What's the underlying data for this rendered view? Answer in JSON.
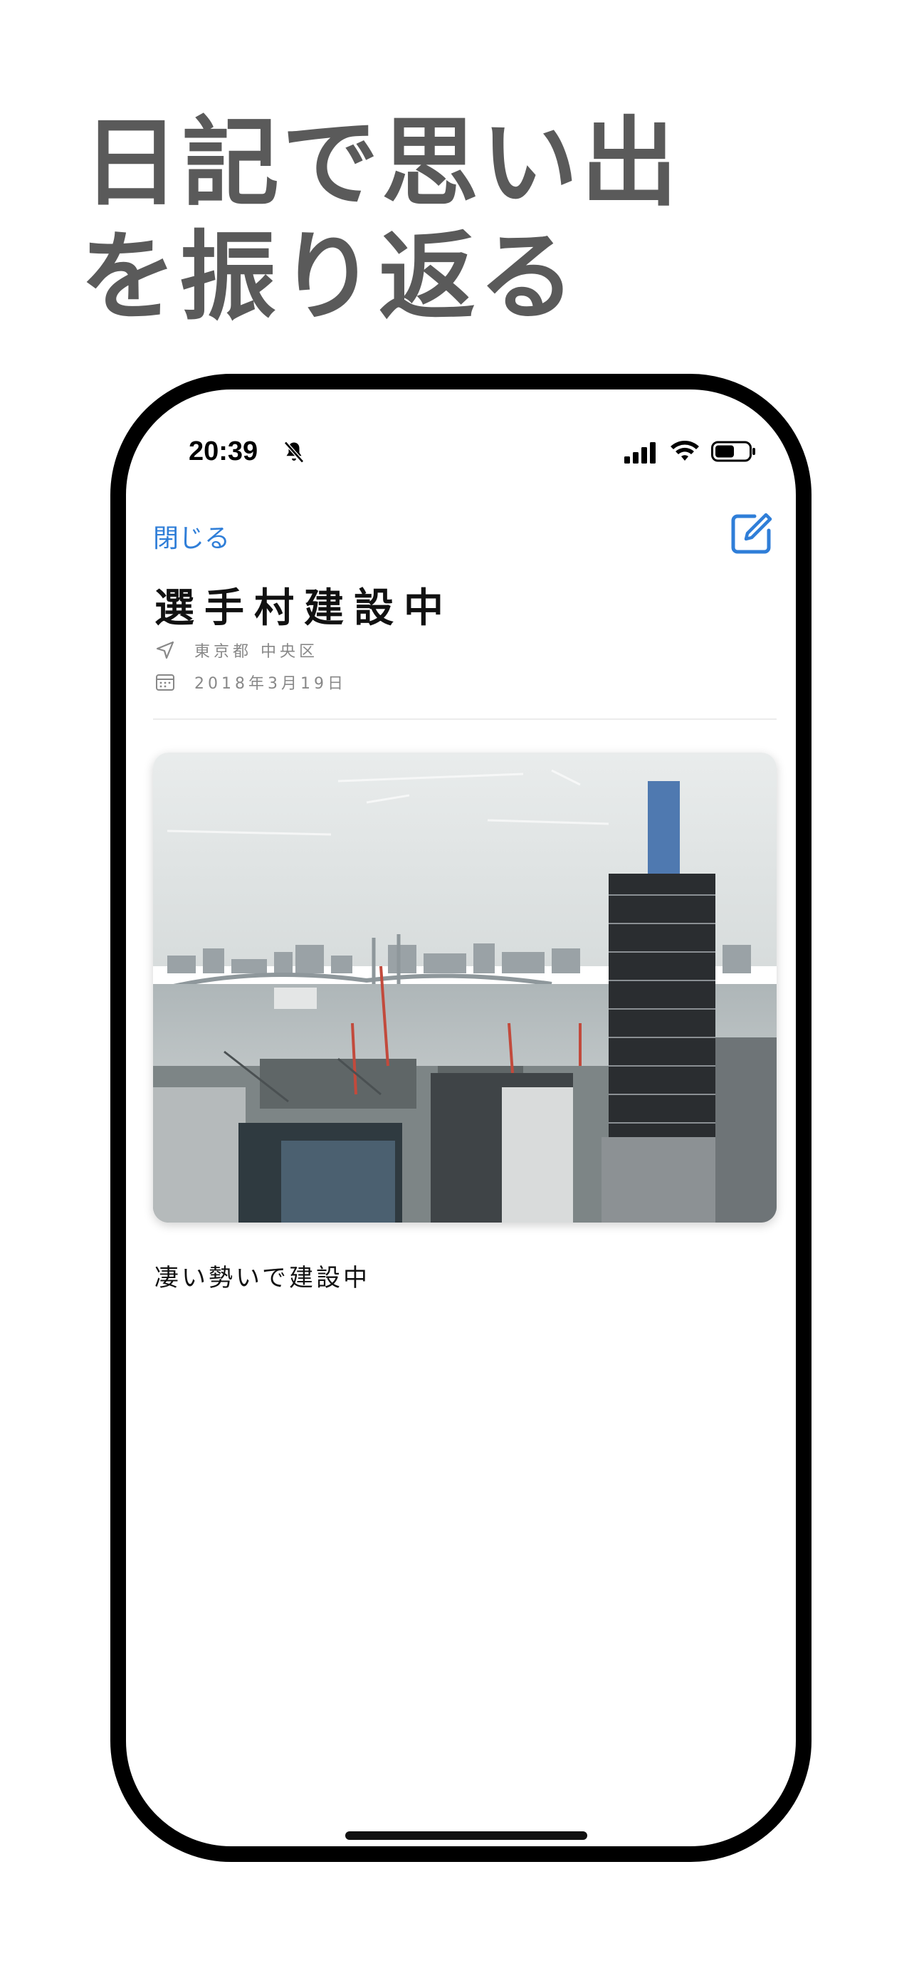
{
  "headline": {
    "line1": "日記で思い出",
    "line2": "を振り返る"
  },
  "status_bar": {
    "time": "20:39",
    "icons": [
      "bell-slash-icon",
      "cellular-signal-icon",
      "wifi-icon",
      "battery-icon"
    ]
  },
  "nav": {
    "close_label": "閉じる",
    "compose_icon": "compose-icon",
    "accent_color": "#2f7ed8"
  },
  "entry": {
    "title": "選手村建設中",
    "location": "東京都 中央区",
    "date": "2018年3月19日",
    "caption": "凄い勢いで建設中"
  },
  "icons": {
    "location": "location-arrow-icon",
    "date": "calendar-icon"
  }
}
